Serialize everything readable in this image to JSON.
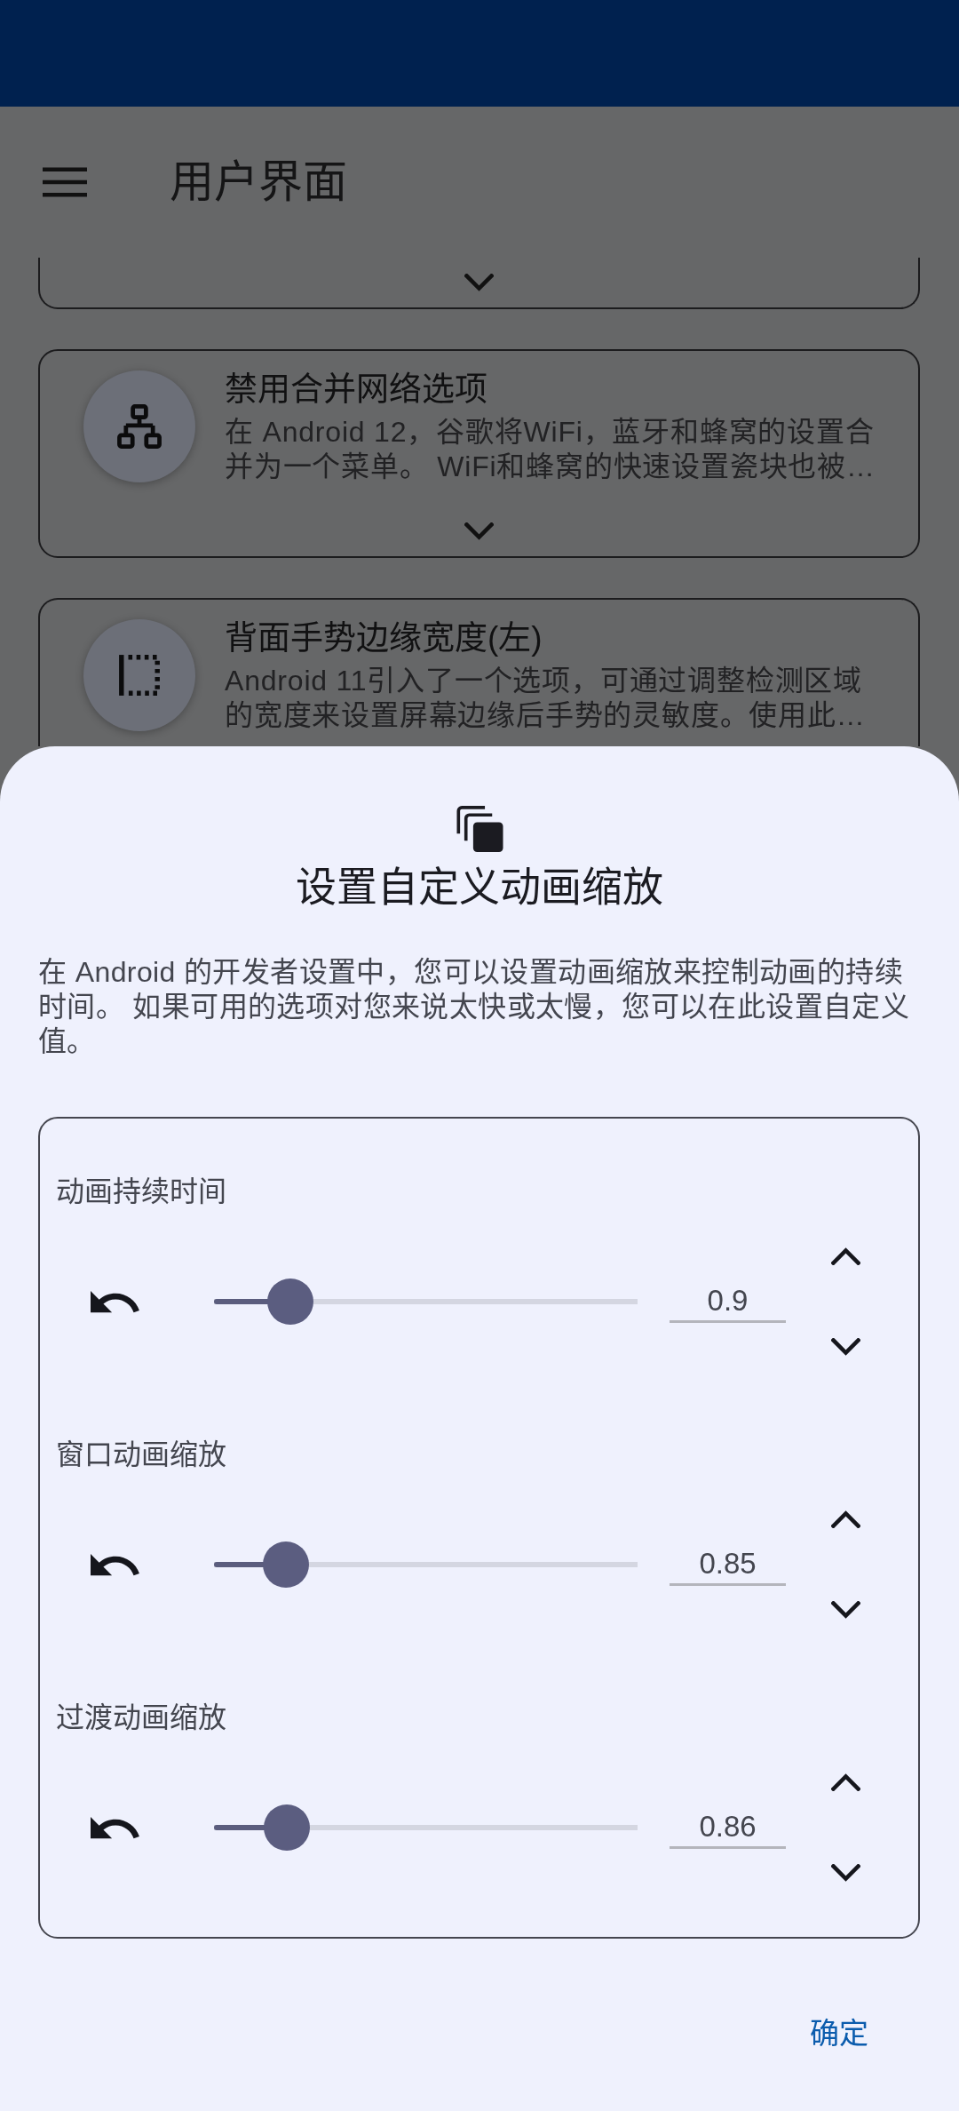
{
  "app_bar": {
    "title": "用户界面"
  },
  "cards": [
    {
      "kind": "chevron-only"
    },
    {
      "kind": "network",
      "title": "禁用合并网络选项",
      "description": "在 Android 12，谷歌将WiFi，蓝牙和蜂窝的设置合并为一个菜单。 WiFi和蜂窝的快速设置瓷块也被…"
    },
    {
      "kind": "screen-edge",
      "title": "背面手势边缘宽度(左)",
      "description": "Android 11引入了一个选项，可通过调整检测区域的宽度来设置屏幕边缘后手势的灵敏度。使用此…"
    }
  ],
  "sheet": {
    "title": "设置自定义动画缩放",
    "description": "在 Android 的开发者设置中，您可以设置动画缩放来控制动画的持续时间。 如果可用的选项对您来说太快或太慢，您可以在此设置自定义值。",
    "sliders": [
      {
        "label": "动画持续时间",
        "level": 0.18,
        "value": "0.9"
      },
      {
        "label": "窗口动画缩放",
        "level": 0.17,
        "value": "0.85"
      },
      {
        "label": "过渡动画缩放",
        "level": 0.172,
        "value": "0.86"
      }
    ],
    "confirm_button": "确定"
  }
}
